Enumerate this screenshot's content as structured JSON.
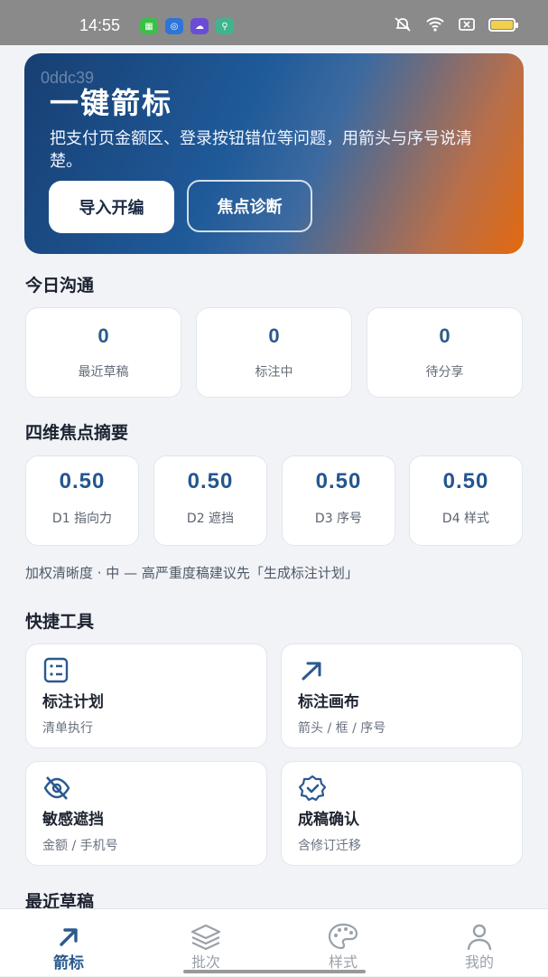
{
  "status": {
    "time": "14:55",
    "apps": [
      {
        "icon": "green-app-icon",
        "color": "#3bbf45"
      },
      {
        "icon": "blue-browser-icon",
        "color": "#2f74d8"
      },
      {
        "icon": "purple-cloud-icon",
        "color": "#6b4cd6"
      },
      {
        "icon": "teal-location-icon",
        "color": "#3fb58e"
      }
    ],
    "icons": [
      "mute-icon",
      "wifi-icon",
      "close-box-icon",
      "battery-icon"
    ]
  },
  "hero": {
    "watermark": "0ddc39",
    "title": "一键箭标",
    "description": "把支付页金额区、登录按钮错位等问题，用箭头与序号说清楚。",
    "primary_button": "导入开编",
    "secondary_button": "焦点诊断",
    "gradient": [
      "#173f73",
      "#1f5a99",
      "#e3690f"
    ]
  },
  "today": {
    "title": "今日沟通",
    "stats": [
      {
        "value": "0",
        "label": "最近草稿"
      },
      {
        "value": "0",
        "label": "标注中"
      },
      {
        "value": "0",
        "label": "待分享"
      }
    ]
  },
  "summary": {
    "title": "四维焦点摘要",
    "scores": [
      {
        "value": "0.50",
        "label": "D1 指向力"
      },
      {
        "value": "0.50",
        "label": "D2 遮挡"
      },
      {
        "value": "0.50",
        "label": "D3 序号"
      },
      {
        "value": "0.50",
        "label": "D4 样式"
      }
    ],
    "note": "加权清晰度 · 中 — 高严重度稿建议先「生成标注计划」"
  },
  "tools": {
    "title": "快捷工具",
    "items": [
      {
        "icon": "checklist-icon",
        "title": "标注计划",
        "subtitle": "清单执行"
      },
      {
        "icon": "arrow-up-right-icon",
        "title": "标注画布",
        "subtitle": "箭头 / 框 / 序号"
      },
      {
        "icon": "eye-off-icon",
        "title": "敏感遮挡",
        "subtitle": "金额 / 手机号"
      },
      {
        "icon": "verified-badge-icon",
        "title": "成稿确认",
        "subtitle": "含修订迁移"
      }
    ]
  },
  "recent": {
    "title": "最近草稿"
  },
  "nav": {
    "items": [
      {
        "label": "箭标",
        "icon": "arrow-up-right-icon",
        "active": true
      },
      {
        "label": "批次",
        "icon": "layers-icon",
        "active": false
      },
      {
        "label": "样式",
        "icon": "palette-icon",
        "active": false
      },
      {
        "label": "我的",
        "icon": "user-icon",
        "active": false
      }
    ]
  },
  "colors": {
    "accent": "#2b5a8c",
    "orange": "#e3690f",
    "background": "#f1f3f7"
  }
}
